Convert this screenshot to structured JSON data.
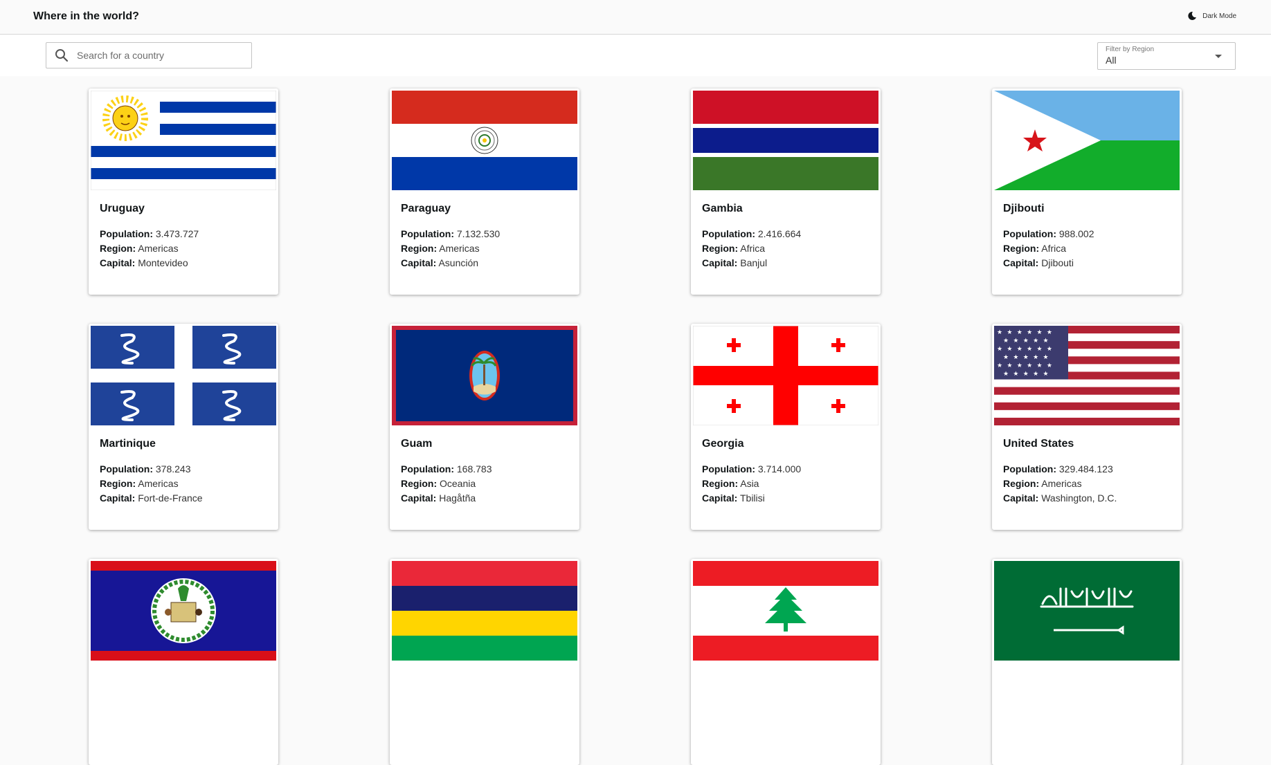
{
  "header": {
    "title": "Where in the world?",
    "dark_mode_label": "Dark Mode"
  },
  "toolbar": {
    "search_placeholder": "Search for a country",
    "search_value": "",
    "filter_label": "Filter by Region",
    "filter_value": "All"
  },
  "labels": {
    "population": "Population:",
    "region": "Region:",
    "capital": "Capital:"
  },
  "countries": [
    {
      "name": "Uruguay",
      "population": "3.473.727",
      "region": "Americas",
      "capital": "Montevideo",
      "flag": "uruguay-flag"
    },
    {
      "name": "Paraguay",
      "population": "7.132.530",
      "region": "Americas",
      "capital": "Asunción",
      "flag": "paraguay-flag"
    },
    {
      "name": "Gambia",
      "population": "2.416.664",
      "region": "Africa",
      "capital": "Banjul",
      "flag": "gambia-flag"
    },
    {
      "name": "Djibouti",
      "population": "988.002",
      "region": "Africa",
      "capital": "Djibouti",
      "flag": "djibouti-flag"
    },
    {
      "name": "Martinique",
      "population": "378.243",
      "region": "Americas",
      "capital": "Fort-de-France",
      "flag": "martinique-flag"
    },
    {
      "name": "Guam",
      "population": "168.783",
      "region": "Oceania",
      "capital": "Hagåtña",
      "flag": "guam-flag"
    },
    {
      "name": "Georgia",
      "population": "3.714.000",
      "region": "Asia",
      "capital": "Tbilisi",
      "flag": "georgia-flag"
    },
    {
      "name": "United States",
      "population": "329.484.123",
      "region": "Americas",
      "capital": "Washington, D.C.",
      "flag": "usa-flag"
    },
    {
      "flag": "belize-flag"
    },
    {
      "flag": "mauritius-flag"
    },
    {
      "flag": "lebanon-flag"
    },
    {
      "flag": "saudi-arabia-flag"
    }
  ],
  "colors": {
    "background": "#fafafa",
    "card": "#ffffff",
    "text": "#111517"
  }
}
